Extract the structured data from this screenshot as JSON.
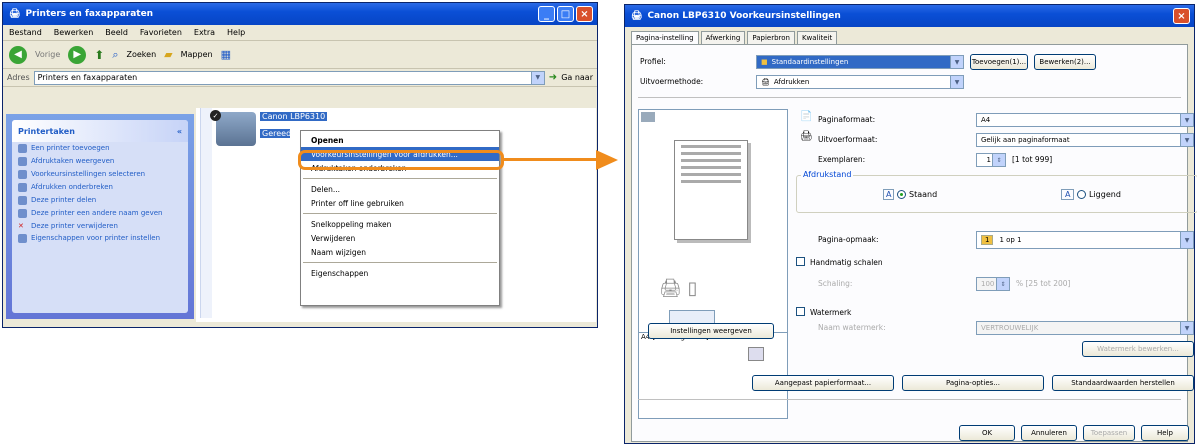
{
  "explorer": {
    "title": "Printers en faxapparaten",
    "menu": [
      "Bestand",
      "Bewerken",
      "Beeld",
      "Favorieten",
      "Extra",
      "Help"
    ],
    "toolbar": {
      "back": "Vorige",
      "search": "Zoeken",
      "folders": "Mappen"
    },
    "address_label": "Adres",
    "address_value": "Printers en faxapparaten",
    "go": "Ga naar",
    "task_header": "Printertaken",
    "tasks": [
      "Een printer toevoegen",
      "Afdruktaken weergeven",
      "Voorkeursinstellingen selecteren",
      "Afdrukken onderbreken",
      "Deze printer delen",
      "Deze printer een andere naam geven",
      "Deze printer verwijderen",
      "Eigenschappen voor printer instellen"
    ],
    "printer_name": "Canon LBP6310",
    "printer_status": "Gereed"
  },
  "context_menu": {
    "open": "Openen",
    "items": [
      "Voorkeursinstellingen voor afdrukken...",
      "Afdruktaken onderbreken",
      "Delen...",
      "Printer off line gebruiken",
      "Snelkoppeling maken",
      "Verwijderen",
      "Naam wijzigen",
      "Eigenschappen"
    ]
  },
  "dialog": {
    "title": "Canon LBP6310 Voorkeursinstellingen",
    "tabs": [
      "Pagina-instelling",
      "Afwerking",
      "Papierbron",
      "Kwaliteit"
    ],
    "profile_label": "Profiel:",
    "profile_value": "Standaardinstellingen",
    "add_btn": "Toevoegen(1)...",
    "edit_btn": "Bewerken(2)...",
    "output_label": "Uitvoermethode:",
    "output_value": "Afdrukken",
    "page_size_label": "Paginaformaat:",
    "page_size_value": "A4",
    "output_size_label": "Uitvoerformaat:",
    "output_size_value": "Gelijk aan paginaformaat",
    "copies_label": "Exemplaren:",
    "copies_value": "1",
    "copies_range": "[1 tot 999]",
    "orientation_label": "Afdrukstand",
    "portrait": "Staand",
    "landscape": "Liggend",
    "layout_label": "Pagina-opmaak:",
    "layout_value": "1 op 1",
    "manual_scale": "Handmatig schalen",
    "scaling_label": "Schaling:",
    "scaling_value": "100",
    "scaling_range": "% [25 tot 200]",
    "watermark": "Watermerk",
    "watermark_name_label": "Naam watermerk:",
    "watermark_value": "VERTROUWELIJK",
    "watermark_edit": "Watermerk bewerken...",
    "preview_caption": "A4 [Schaling: Auto]",
    "show_settings": "Instellingen weergeven",
    "custom_paper": "Aangepast papierformaat...",
    "page_options": "Pagina-opties...",
    "restore_defaults": "Standaardwaarden herstellen",
    "ok": "OK",
    "cancel": "Annuleren",
    "apply": "Toepassen",
    "help": "Help"
  },
  "colors": {
    "highlight": "#f08c1c",
    "xp_blue": "#0a4fd6"
  }
}
